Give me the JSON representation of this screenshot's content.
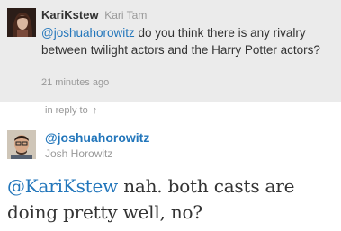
{
  "reply_tweet": {
    "screen_name": "KariKstew",
    "full_name": "Kari Tam",
    "mention": "@joshuahorowitz",
    "text": " do you think there is any rivalry between twilight actors and the Harry Potter actors?",
    "timestamp": "21 minutes ago"
  },
  "in_reply": {
    "label": "in reply to",
    "icon": "arrow-up-icon",
    "glyph": "↑"
  },
  "main_tweet": {
    "screen_name": "@joshuahorowitz",
    "full_name": "Josh Horowitz",
    "mention": "@KariKstew",
    "text": " nah. both casts are doing pretty well, no?"
  },
  "colors": {
    "link": "#2276bb",
    "muted": "#999999",
    "reply_background": "#ebebeb"
  }
}
